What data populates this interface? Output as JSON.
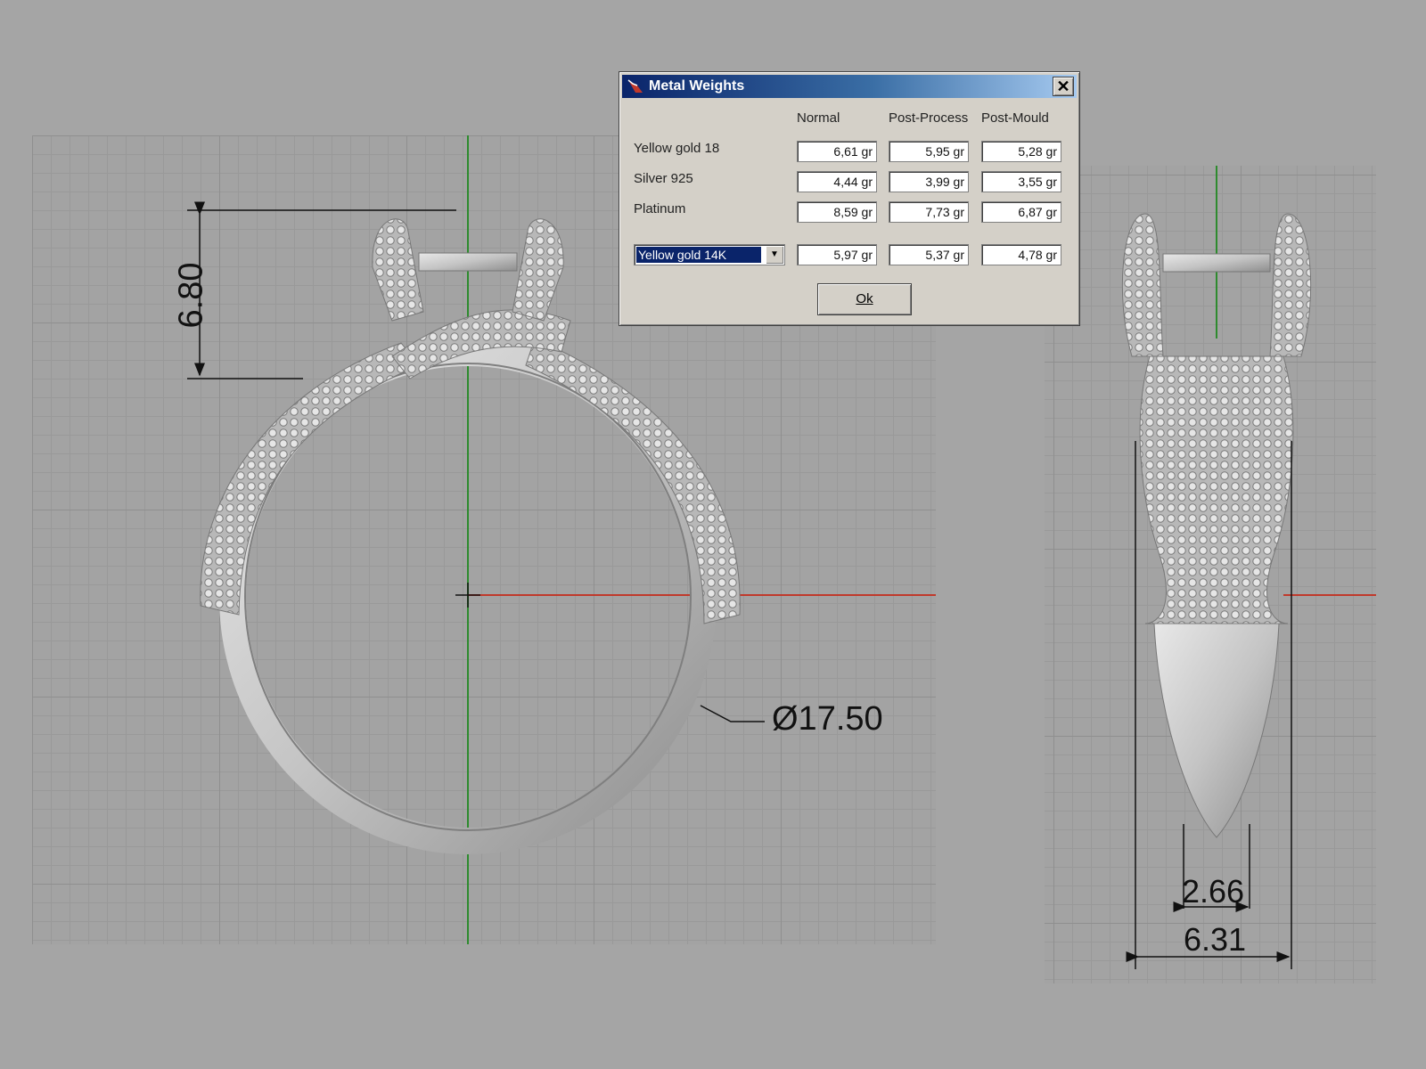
{
  "dialog": {
    "title": "Metal Weights",
    "close_label": "✕",
    "columns": [
      "Normal",
      "Post-Process",
      "Post-Mould"
    ],
    "rows": [
      {
        "label": "Yellow gold 18",
        "values": [
          "6,61 gr",
          "5,95 gr",
          "5,28 gr"
        ]
      },
      {
        "label": "Silver 925",
        "values": [
          "4,44 gr",
          "3,99 gr",
          "3,55 gr"
        ]
      },
      {
        "label": "Platinum",
        "values": [
          "8,59 gr",
          "7,73 gr",
          "6,87 gr"
        ]
      }
    ],
    "custom_row": {
      "selected_metal": "Yellow gold 14K",
      "values": [
        "5,97 gr",
        "5,37 gr",
        "4,78 gr"
      ]
    },
    "ok_label": "Ok"
  },
  "dimensions": {
    "height": "6.80",
    "diameter": "Ø17.50",
    "inner_width": "2.66",
    "outer_width": "6.31"
  },
  "colors": {
    "x_axis": "#c0392b",
    "y_axis": "#2e8b2e",
    "metal": "#cfcfcf"
  }
}
